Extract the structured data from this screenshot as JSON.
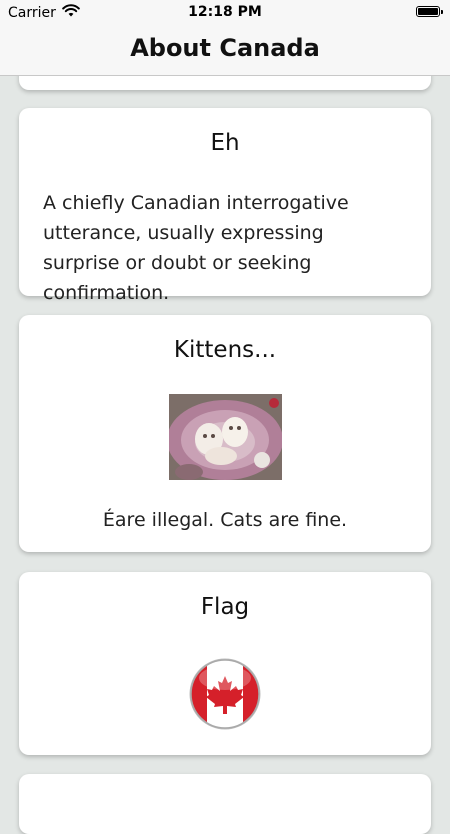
{
  "status_bar": {
    "carrier": "Carrier",
    "time": "12:18 PM"
  },
  "nav": {
    "title": "About Canada"
  },
  "cards": [
    {
      "title": "Eh",
      "text": "A chiefly Canadian interrogative utterance, usually expressing surprise or doubt or seeking confirmation."
    },
    {
      "title": "Kittens...",
      "text": "Éare illegal. Cats are fine."
    },
    {
      "title": "Flag"
    }
  ],
  "colors": {
    "background": "#e3e7e5",
    "flag_red": "#d5202a"
  }
}
